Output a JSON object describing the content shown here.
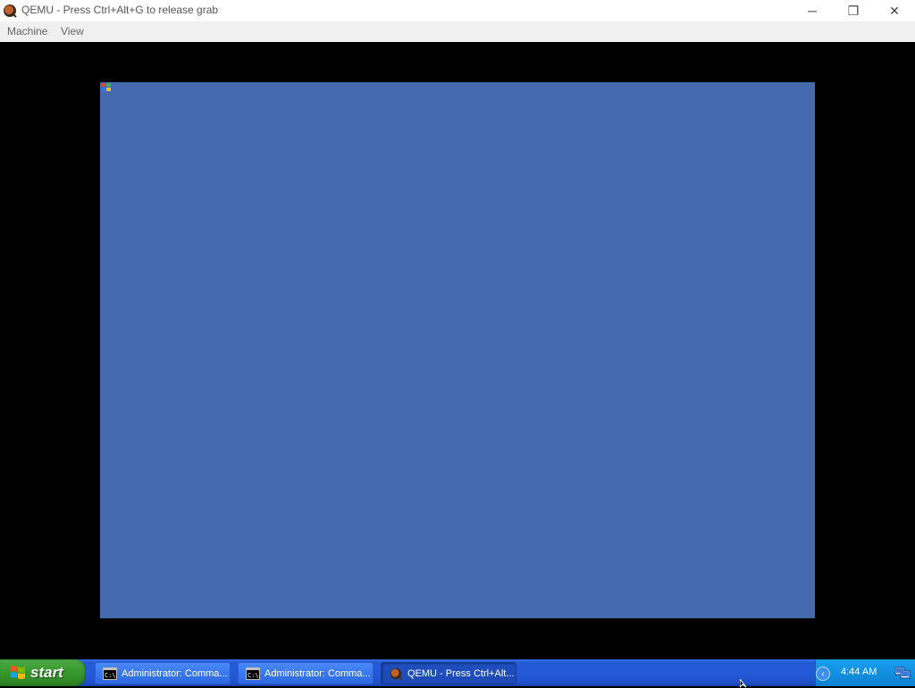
{
  "window": {
    "title": "QEMU - Press Ctrl+Alt+G to release grab",
    "icon": "qemu-icon",
    "controls": {
      "minimize": "─",
      "maximize": "❐",
      "close": "✕"
    }
  },
  "menu": {
    "items": [
      {
        "label": "Machine"
      },
      {
        "label": "View"
      }
    ]
  },
  "guest": {
    "background_color": "#4469ad"
  },
  "taskbar": {
    "start_label": "start",
    "tasks": [
      {
        "label": "Administrator: Comma...",
        "icon": "cmd-icon",
        "active": false
      },
      {
        "label": "Administrator: Comma...",
        "icon": "cmd-icon",
        "active": false
      },
      {
        "label": "QEMU - Press Ctrl+Alt...",
        "icon": "qemu-icon",
        "active": true
      }
    ],
    "tray": {
      "chevron": "‹",
      "clock": "4:44 AM",
      "icon": "network-icon"
    }
  },
  "colors": {
    "taskbar_blue": "#235ad7",
    "start_green": "#379a2d",
    "tray_blue": "#1290e0"
  }
}
